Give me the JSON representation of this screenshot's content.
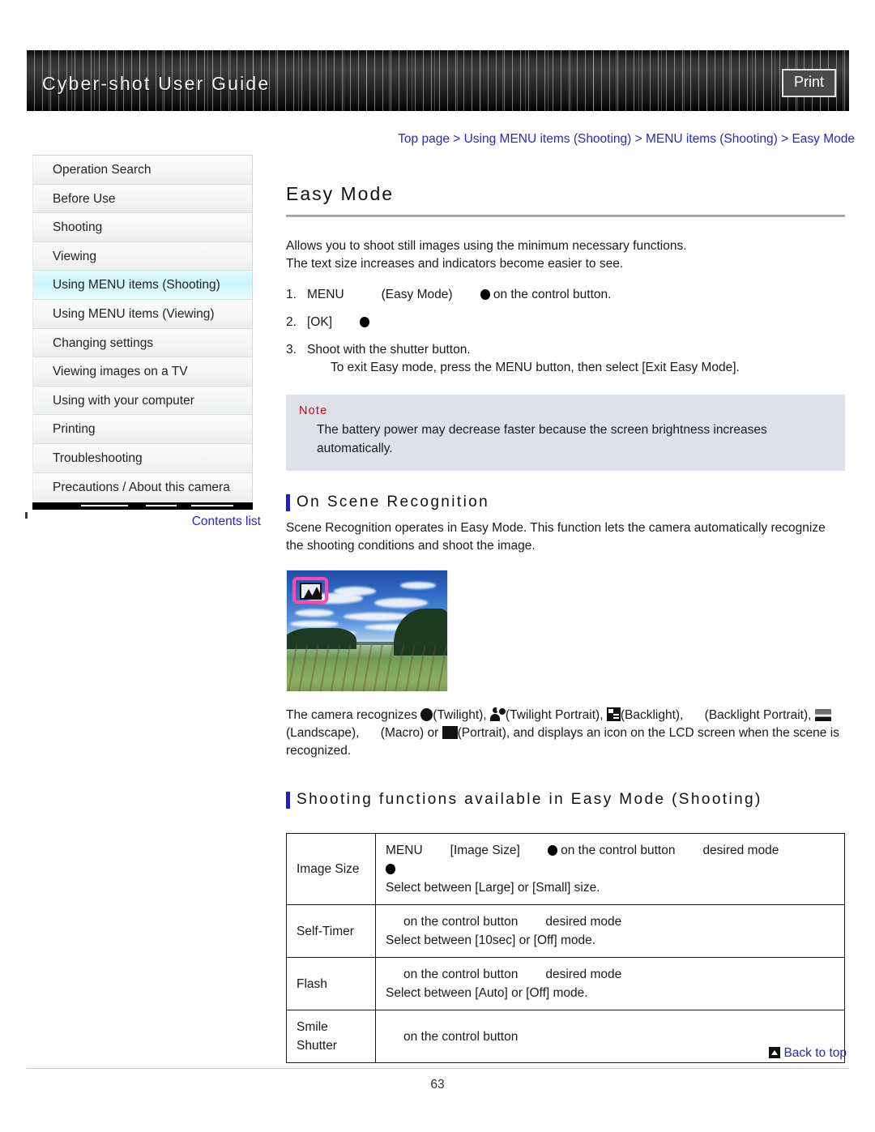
{
  "header": {
    "title": "Cyber-shot User Guide",
    "print_label": "Print"
  },
  "breadcrumb": {
    "text": "Top page > Using MENU items (Shooting) > MENU items (Shooting) > Easy Mode"
  },
  "sidebar": {
    "items": [
      {
        "label": "Operation Search",
        "active": false
      },
      {
        "label": "Before Use",
        "active": false
      },
      {
        "label": "Shooting",
        "active": false
      },
      {
        "label": "Viewing",
        "active": false
      },
      {
        "label": "Using MENU items (Shooting)",
        "active": true
      },
      {
        "label": "Using MENU items (Viewing)",
        "active": false
      },
      {
        "label": "Changing settings",
        "active": false
      },
      {
        "label": "Viewing images on a TV",
        "active": false
      },
      {
        "label": "Using with your computer",
        "active": false
      },
      {
        "label": "Printing",
        "active": false
      },
      {
        "label": "Troubleshooting",
        "active": false
      },
      {
        "label": "Precautions / About this camera",
        "active": false
      }
    ],
    "contents_list_label": "Contents list"
  },
  "main": {
    "title": "Easy Mode",
    "intro_line1": "Allows you to shoot still images using the minimum necessary functions.",
    "intro_line2": "The text size increases and indicators become easier to see.",
    "steps": [
      {
        "num": "1.",
        "part1": "MENU",
        "part2": "(Easy Mode)",
        "part3": "on the control button."
      },
      {
        "num": "2.",
        "part1": "[OK]",
        "part2": "",
        "part3": ""
      },
      {
        "num": "3.",
        "part1": "Shoot with the shutter button.",
        "part2": "",
        "part3": ""
      }
    ],
    "step3_sub": "To exit Easy mode, press the MENU button, then select [Exit Easy Mode].",
    "note": {
      "label": "Note",
      "text": "The battery power may decrease faster because the screen brightness increases automatically."
    },
    "scene_section": {
      "heading": "On Scene Recognition",
      "body": "Scene Recognition operates in Easy Mode. This function lets the camera automatically recognize the shooting conditions and shoot the image.",
      "recognize_prefix": "The camera recognizes",
      "labels": {
        "twilight": "(Twilight),",
        "twilight_portrait": "(Twilight Portrait),",
        "backlight": "(Backlight),",
        "backlight_portrait": "(Backlight Portrait),",
        "landscape": "(Landscape),",
        "macro": "(Macro) or",
        "portrait": "(Portrait), and displays an icon on the LCD screen"
      },
      "recognize_tail": "when the scene is recognized."
    },
    "functions_section": {
      "heading": "Shooting functions available in Easy Mode (Shooting)",
      "rows": [
        {
          "name": "Image Size",
          "line1_a": "MENU",
          "line1_b": "[Image Size]",
          "line1_c": "on the control button",
          "line1_d": "desired mode",
          "line2_dot": true,
          "line3": "Select between [Large] or [Small] size."
        },
        {
          "name": "Self-Timer",
          "line1_a": "",
          "line1_b": "",
          "line1_c": "on the control button",
          "line1_d": "desired mode",
          "line2_dot": false,
          "line3": "Select between [10sec] or [Off] mode."
        },
        {
          "name": "Flash",
          "line1_a": "",
          "line1_b": "",
          "line1_c": "on the control button",
          "line1_d": "desired mode",
          "line2_dot": false,
          "line3": "Select between [Auto] or [Off] mode."
        },
        {
          "name_line1": "Smile",
          "name_line2": "Shutter",
          "name": "Smile Shutter",
          "line1_a": "",
          "line1_b": "",
          "line1_c": "on the control button",
          "line1_d": "",
          "line2_dot": false,
          "line3": ""
        }
      ]
    }
  },
  "footer": {
    "back_to_top": "Back to top",
    "page_number": "63"
  },
  "colors": {
    "link": "#2828c8",
    "note_bg": "#dfe1e8",
    "note_label": "#d0021b",
    "sidebar_active": "#ccf4fb",
    "accent_bar": "#2222cc",
    "highlight_box": "#ff49b0"
  }
}
